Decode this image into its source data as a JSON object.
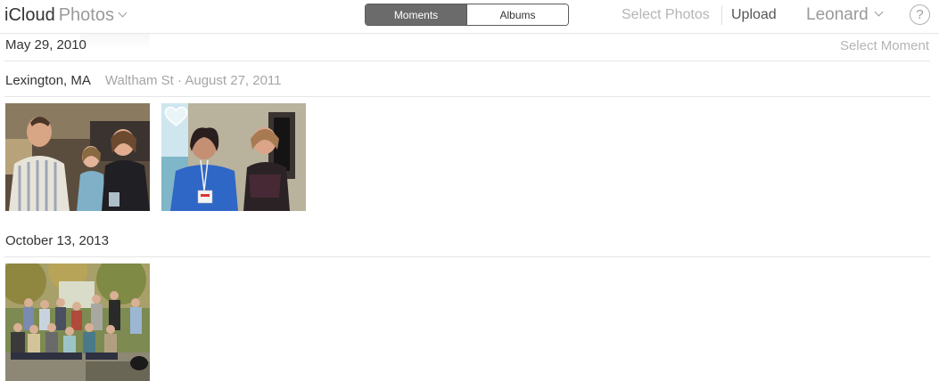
{
  "header": {
    "brand_icloud": "iCloud",
    "brand_photos": "Photos",
    "view_tabs": [
      {
        "label": "Moments",
        "active": true
      },
      {
        "label": "Albums",
        "active": false
      }
    ],
    "select_photos": "Select Photos",
    "upload": "Upload",
    "user_name": "Leonard",
    "help": "?"
  },
  "moments": [
    {
      "date": "May 29, 2010",
      "action": "Select Moment"
    },
    {
      "place": "Lexington, MA",
      "detail": "Waltham St · August 27, 2011",
      "photos": [
        "group-photo-three-people",
        "two-women-photo"
      ]
    },
    {
      "date": "October 13, 2013",
      "photos": [
        "large-group-outdoor-photo"
      ]
    }
  ],
  "colors": {
    "active_tab_bg": "#6b6b6b",
    "muted_text": "#a5a5a5",
    "divider": "#e6e6e6"
  }
}
